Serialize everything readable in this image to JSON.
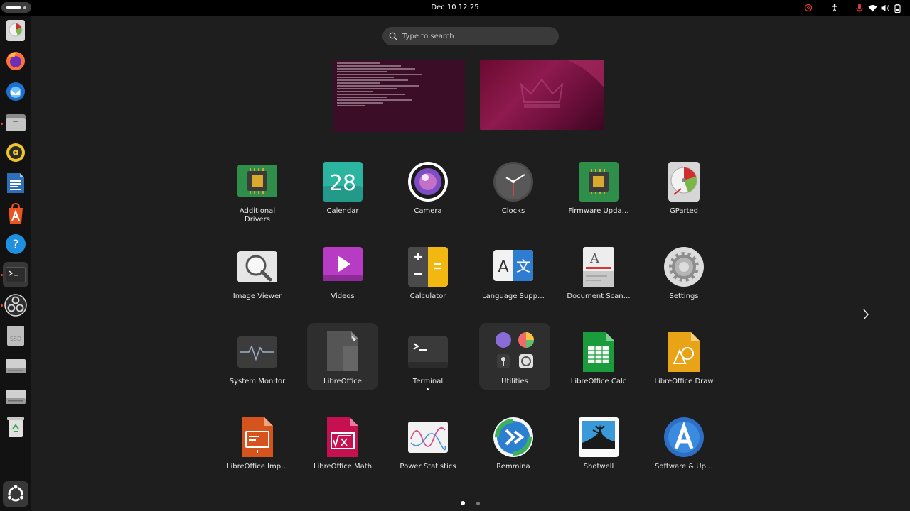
{
  "topbar": {
    "datetime": "Dec 10  12:25"
  },
  "search": {
    "placeholder": "Type to search"
  },
  "dock": {
    "items": [
      {
        "name": "gparted-icon"
      },
      {
        "name": "firefox-icon"
      },
      {
        "name": "thunderbird-icon"
      },
      {
        "name": "files-icon"
      },
      {
        "name": "rhythmbox-icon"
      },
      {
        "name": "libreoffice-writer-icon"
      },
      {
        "name": "app-center-icon"
      },
      {
        "name": "help-icon"
      },
      {
        "name": "terminal-icon"
      },
      {
        "name": "obs-icon"
      },
      {
        "name": "ssd-drive-icon"
      },
      {
        "name": "drive-icon"
      },
      {
        "name": "drive-icon"
      },
      {
        "name": "trash-icon"
      }
    ],
    "show_apps_icon": "ubuntu-logo-icon"
  },
  "apps": [
    {
      "label": "Additional\nDrivers",
      "icon": "chip-icon"
    },
    {
      "label": "Calendar",
      "icon": "calendar-icon",
      "day": "28"
    },
    {
      "label": "Camera",
      "icon": "camera-icon"
    },
    {
      "label": "Clocks",
      "icon": "clock-icon"
    },
    {
      "label": "Firmware Upda…",
      "icon": "chip-icon"
    },
    {
      "label": "GParted",
      "icon": "gparted-icon"
    },
    {
      "label": "Image Viewer",
      "icon": "image-viewer-icon"
    },
    {
      "label": "Videos",
      "icon": "videos-icon"
    },
    {
      "label": "Calculator",
      "icon": "calculator-icon"
    },
    {
      "label": "Language Supp…",
      "icon": "language-icon"
    },
    {
      "label": "Document Scan…",
      "icon": "scanner-icon"
    },
    {
      "label": "Settings",
      "icon": "settings-gear-icon"
    },
    {
      "label": "System Monitor",
      "icon": "system-monitor-icon"
    },
    {
      "label": "LibreOffice",
      "icon": "libreoffice-icon"
    },
    {
      "label": "Terminal",
      "icon": "terminal-icon"
    },
    {
      "label": "Utilities",
      "icon": "folder-utilities-icon"
    },
    {
      "label": "LibreOffice Calc",
      "icon": "calc-icon"
    },
    {
      "label": "LibreOffice Draw",
      "icon": "draw-icon"
    },
    {
      "label": "LibreOffice Imp…",
      "icon": "impress-icon"
    },
    {
      "label": "LibreOffice Math",
      "icon": "math-icon"
    },
    {
      "label": "Power Statistics",
      "icon": "power-statistics-icon"
    },
    {
      "label": "Remmina",
      "icon": "remmina-icon"
    },
    {
      "label": "Shotwell",
      "icon": "shotwell-icon"
    },
    {
      "label": "Software & Up…",
      "icon": "software-updates-icon"
    }
  ],
  "pager": {
    "pages": 2,
    "current": 1
  },
  "colors": {
    "accent": "#e95420",
    "background": "#1e1e1e",
    "panel": "#000000"
  }
}
